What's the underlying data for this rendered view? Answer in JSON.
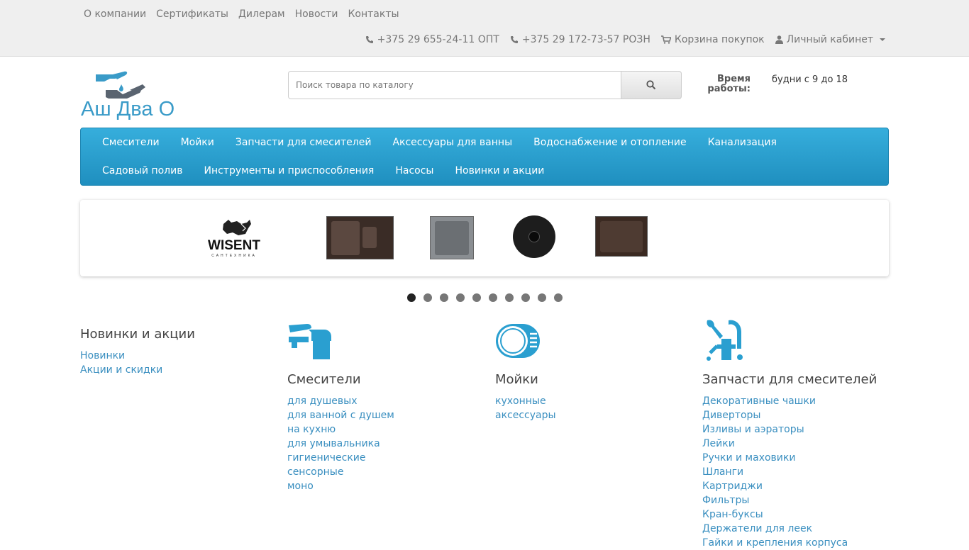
{
  "topnav": [
    "О компании",
    "Сертификаты",
    "Дилерам",
    "Новости",
    "Контакты"
  ],
  "contacts": {
    "phone_opt": "+375 29 655-24-11 ОПТ",
    "phone_rozn": "+375 29 172-73-57 РОЗН",
    "cart": "Корзина покупок",
    "account": "Личный кабинет"
  },
  "logo": {
    "text": "Аш Два О"
  },
  "search": {
    "placeholder": "Поиск товара по каталогу"
  },
  "hours": {
    "label": "Время работы:",
    "value": "будни с 9 до 18"
  },
  "mainnav": [
    "Смесители",
    "Мойки",
    "Запчасти для смесителей",
    "Аксессуары для ванны",
    "Водоснабжение и отопление",
    "Канализация",
    "Садовый полив",
    "Инструменты и приспособления",
    "Насосы",
    "Новинки и акции"
  ],
  "carousel": {
    "brand": "WISENT",
    "brand_sub": "САНТЕХНИКА",
    "dots": 10,
    "active_dot": 0
  },
  "categories": [
    {
      "title": "Новинки и акции",
      "links": [
        "Новинки",
        "Акции и скидки"
      ]
    },
    {
      "title": "Смесители",
      "icon": "faucet-icon",
      "links": [
        "для душевых",
        "для ванной с душем",
        "на кухню",
        "для умывальника",
        "гигиенические",
        "сенсорные",
        "моно"
      ]
    },
    {
      "title": "Мойки",
      "icon": "sink-icon",
      "links": [
        "кухонные",
        "аксессуары"
      ]
    },
    {
      "title": "Запчасти для смесителей",
      "icon": "tools-icon",
      "links": [
        "Декоративные чашки",
        "Диверторы",
        "Изливы и аэраторы",
        "Лейки",
        "Ручки и маховики",
        "Шланги",
        "Картриджи",
        "Фильтры",
        "Кран-буксы",
        "Держатели для леек",
        "Гайки и крепления корпуса"
      ]
    }
  ],
  "colors": {
    "accent": "#2a9fd0",
    "link": "#3a8fc0",
    "topbar": "#efefef"
  }
}
